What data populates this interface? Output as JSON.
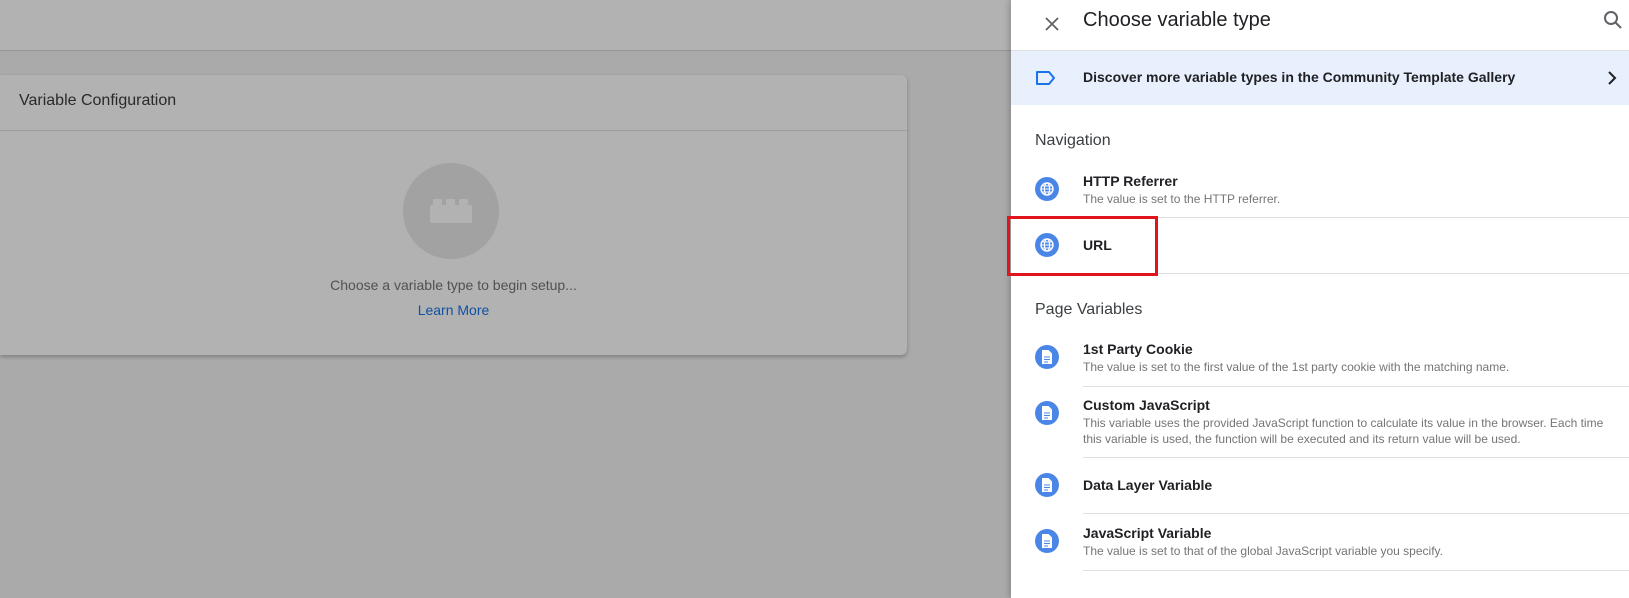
{
  "background": {
    "card_title": "Variable Configuration",
    "empty_state_text": "Choose a variable type to begin setup...",
    "learn_more_label": "Learn More"
  },
  "panel": {
    "title": "Choose variable type",
    "gallery_banner_label": "Discover more variable types in the Community Template Gallery",
    "sections": [
      {
        "header": "Navigation",
        "items": [
          {
            "title": "HTTP Referrer",
            "description": "The value is set to the HTTP referrer.",
            "icon": "globe-icon"
          },
          {
            "title": "URL",
            "description": "",
            "icon": "globe-icon"
          }
        ]
      },
      {
        "header": "Page Variables",
        "items": [
          {
            "title": "1st Party Cookie",
            "description": "The value is set to the first value of the 1st party cookie with the matching name.",
            "icon": "document-icon"
          },
          {
            "title": "Custom JavaScript",
            "description": "This variable uses the provided JavaScript function to calculate its value in the browser. Each time this variable is used, the function will be executed and its return value will be used.",
            "icon": "document-icon"
          },
          {
            "title": "Data Layer Variable",
            "description": "",
            "icon": "document-icon"
          },
          {
            "title": "JavaScript Variable",
            "description": "The value is set to that of the global JavaScript variable you specify.",
            "icon": "document-icon"
          }
        ]
      }
    ]
  },
  "colors": {
    "accent": "#1a73e8",
    "item_icon_bg": "#4a86e8",
    "banner_bg": "#e8f0fe",
    "highlight": "#e0141c"
  }
}
